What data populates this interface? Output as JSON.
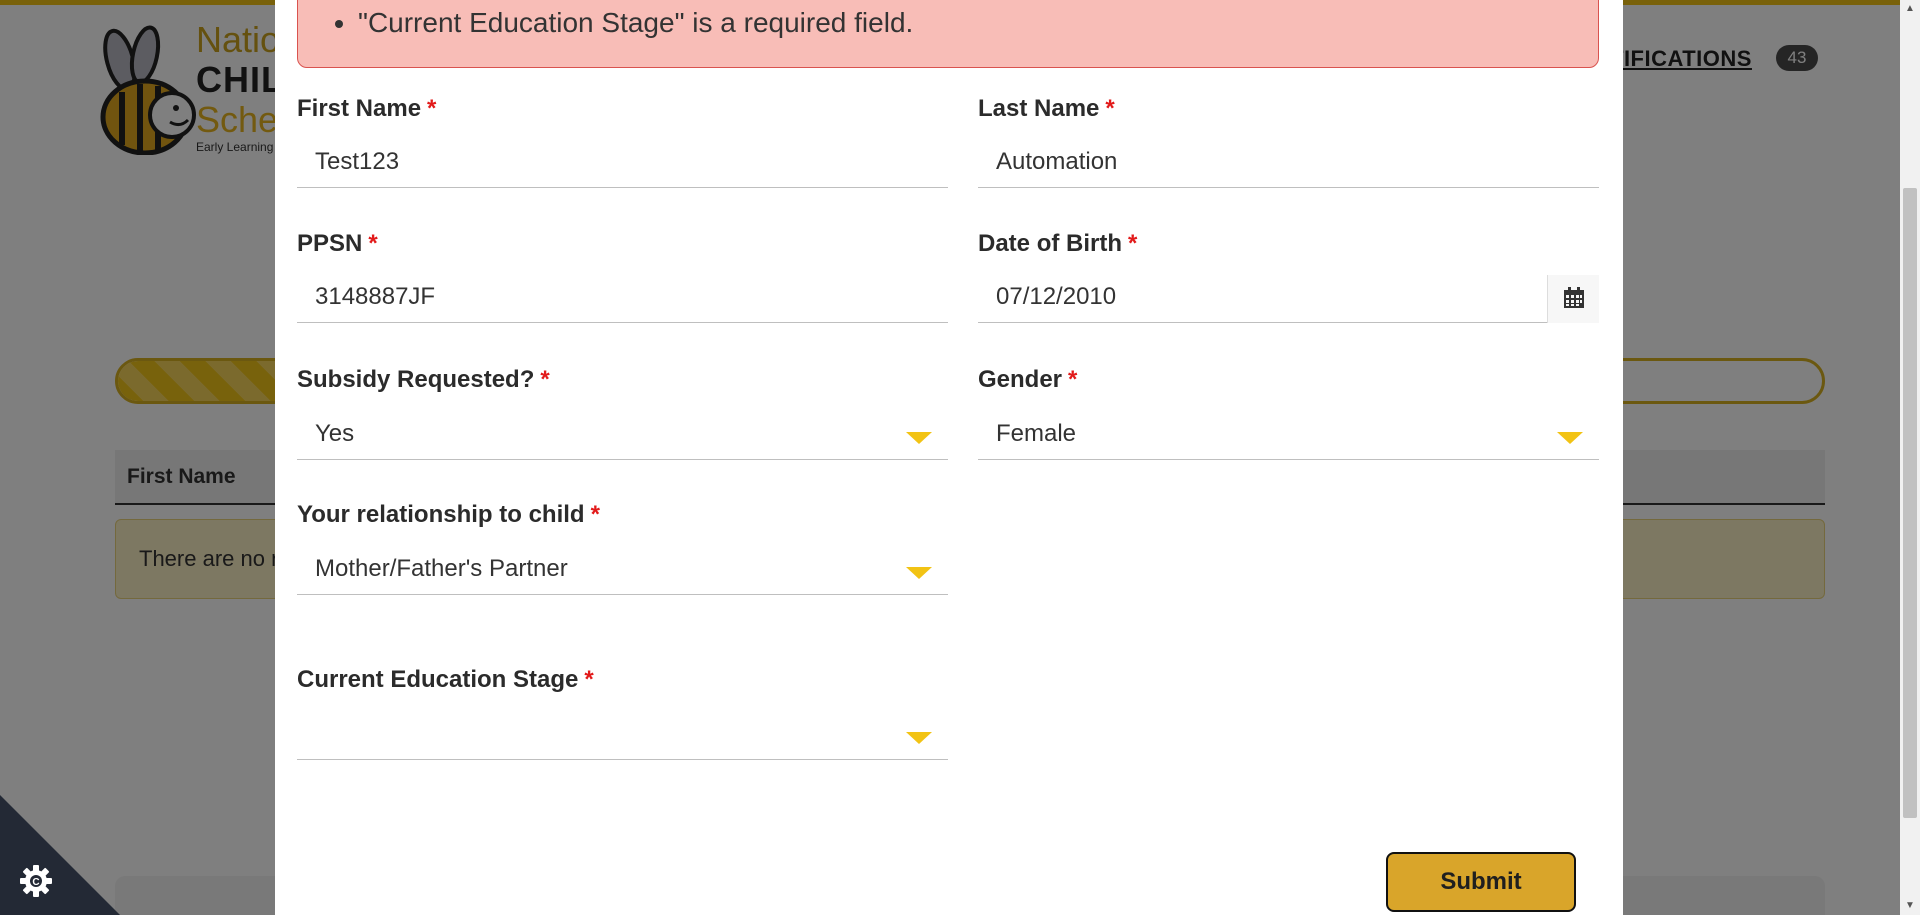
{
  "background": {
    "logo": {
      "line1": "Natio",
      "line2": "CHILDC",
      "line3": "Sche",
      "line4": "Early Learning"
    },
    "notifications_label": "TIFICATIONS",
    "notifications_count": "43",
    "table_header_first_name": "First Name",
    "notice_text": "There are no r"
  },
  "error": {
    "messages": [
      "\"Current Education Stage\" is a required field."
    ]
  },
  "form": {
    "first_name": {
      "label": "First Name",
      "required": "*",
      "value": "Test123"
    },
    "last_name": {
      "label": "Last Name",
      "required": "*",
      "value": "Automation"
    },
    "ppsn": {
      "label": "PPSN",
      "required": "*",
      "value": "3148887JF"
    },
    "dob": {
      "label": "Date of Birth",
      "required": "*",
      "value": "07/12/2010"
    },
    "subsidy": {
      "label": "Subsidy Requested?",
      "required": "*",
      "value": "Yes"
    },
    "gender": {
      "label": "Gender",
      "required": "*",
      "value": "Female"
    },
    "relationship": {
      "label": "Your relationship to child",
      "required": "*",
      "value": "Mother/Father's Partner"
    },
    "education_stage": {
      "label": "Current Education Stage",
      "required": "*",
      "value": ""
    },
    "submit_label": "Submit"
  },
  "colors": {
    "accent": "#f2c314",
    "submit": "#d9a52a",
    "error_bg": "#f8bdb7",
    "required": "#e21a1a"
  }
}
